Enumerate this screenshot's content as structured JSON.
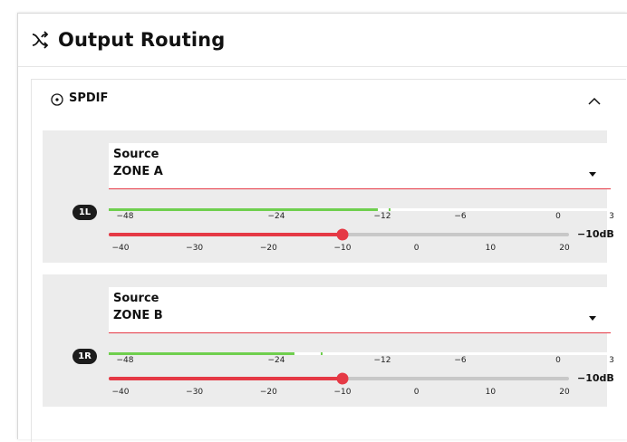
{
  "header": {
    "title": "Output Routing",
    "icon": "shuffle-icon"
  },
  "panel": {
    "label": "SPDIF",
    "icon": "radio-dot-icon",
    "caret": "chevron-up-icon"
  },
  "channels": [
    {
      "badge": "1L",
      "source_label": "Source",
      "source_value": "ZONE A",
      "meter_level_db": -12.5,
      "meter_peak_db": -11.5,
      "gain_value": "−10dB",
      "gain_db": -10
    },
    {
      "badge": "1R",
      "source_label": "Source",
      "source_value": "ZONE B",
      "meter_level_db": -22,
      "meter_peak_db": -19,
      "gain_value": "−10dB",
      "gain_db": -10
    }
  ],
  "meter_ticks": [
    "−48",
    "−24",
    "−12",
    "−6",
    "0",
    "3"
  ],
  "meter_tick_db": [
    -48,
    -24,
    -12,
    -6,
    0,
    3
  ],
  "slider_ticks": [
    "−40",
    "−30",
    "−20",
    "−10",
    "0",
    "10",
    "20"
  ],
  "slider_range": [
    -40,
    20
  ],
  "colors": {
    "accent": "#e53945",
    "meter": "#6fcf4e",
    "channel_bg": "#ececec"
  }
}
